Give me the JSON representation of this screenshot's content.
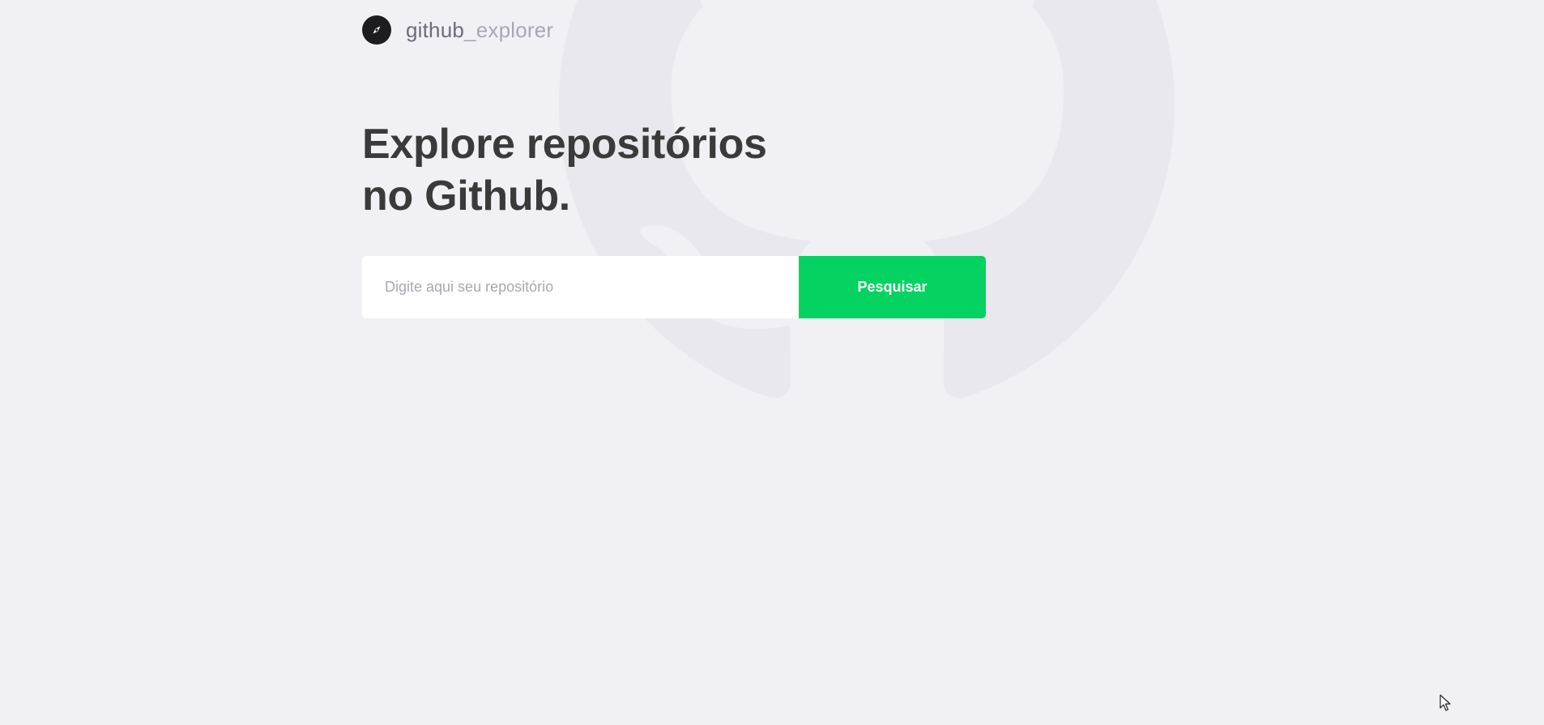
{
  "header": {
    "logo_icon": "compass-icon",
    "logo_text_primary": "github",
    "logo_text_secondary": "_explorer"
  },
  "main": {
    "title_line1": "Explore repositórios",
    "title_line2": "no Github."
  },
  "search": {
    "placeholder": "Digite aqui seu repositório",
    "value": "",
    "button_label": "Pesquisar"
  },
  "colors": {
    "background": "#f0f0f5",
    "title": "#3a3a3a",
    "accent": "#04d361",
    "logo_primary": "#6d6d78",
    "logo_secondary": "#a8a8b3"
  },
  "decor": {
    "background_icon": "github-octocat-icon"
  }
}
